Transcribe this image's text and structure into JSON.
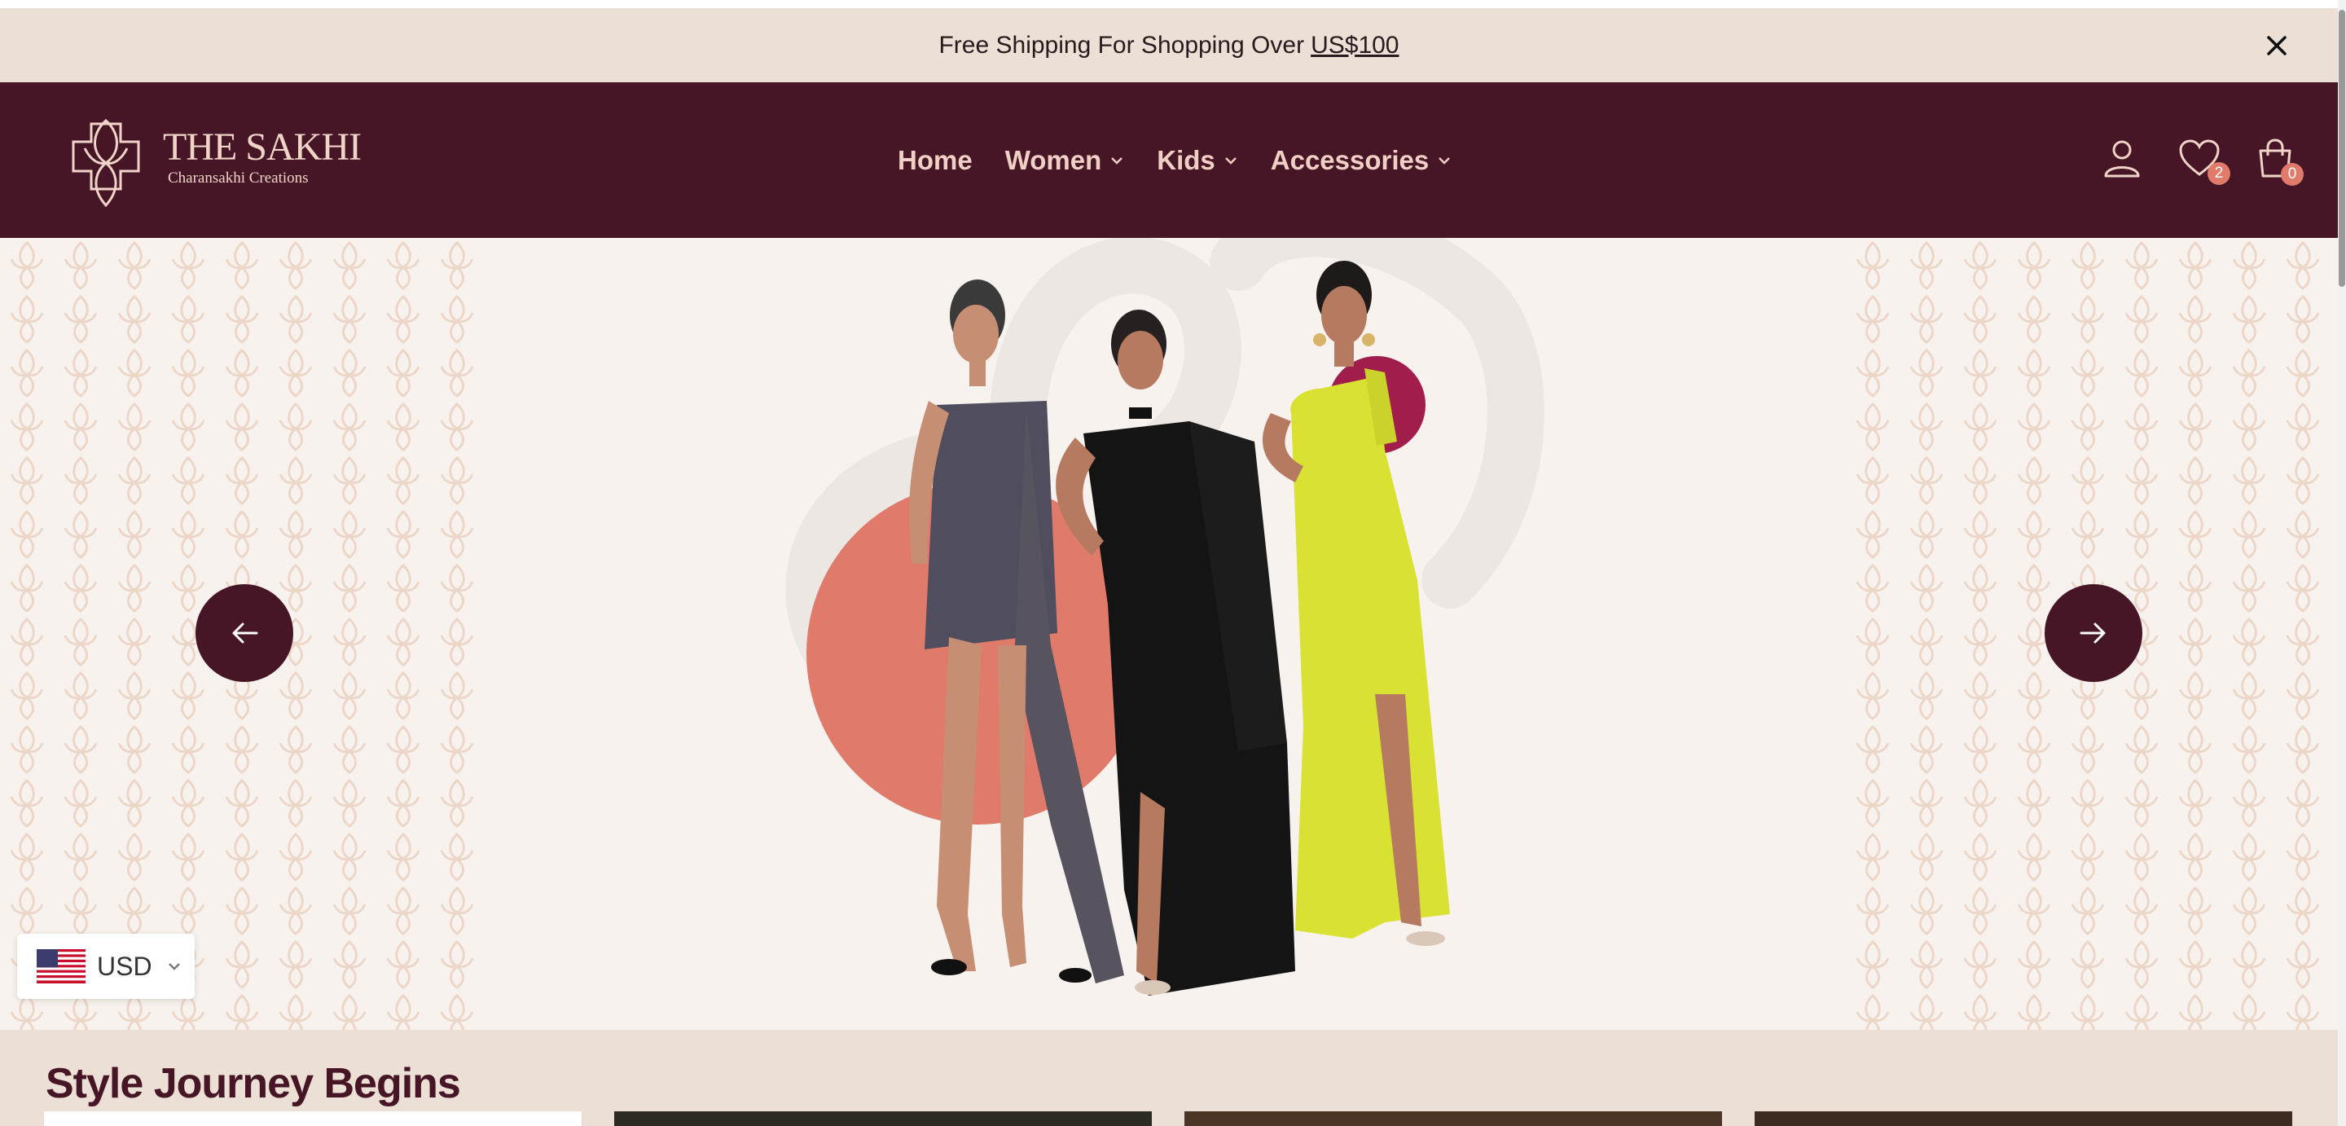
{
  "announcement": {
    "text": "Free Shipping For Shopping Over",
    "link": "US$100"
  },
  "brand": {
    "name": "THE SAKHI",
    "tagline": "Charansakhi Creations"
  },
  "nav": {
    "items": [
      {
        "label": "Home",
        "has_dropdown": false
      },
      {
        "label": "Women",
        "has_dropdown": true
      },
      {
        "label": "Kids",
        "has_dropdown": true
      },
      {
        "label": "Accessories",
        "has_dropdown": true
      }
    ]
  },
  "header_icons": {
    "account": "user-icon",
    "wishlist": "heart-icon",
    "wishlist_count": "2",
    "cart": "shopping-bag-icon",
    "cart_count": "0"
  },
  "hero": {
    "prev": "arrow-left-icon",
    "next": "arrow-right-icon"
  },
  "currency": {
    "code": "USD",
    "flag": "us-flag-icon"
  },
  "section": {
    "title": "Style Journey Begins"
  },
  "colors": {
    "header_bg": "#461626",
    "announce_bg": "#ebdfd6",
    "hero_bg": "#f8f2ee",
    "accent_coral": "#e07a6a",
    "nav_text": "#f0d0c4"
  }
}
